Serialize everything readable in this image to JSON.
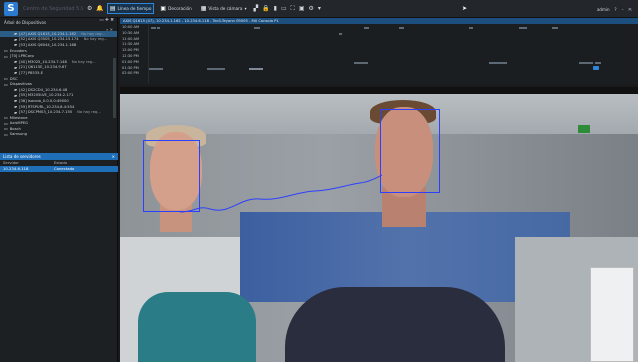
{
  "app": {
    "title": "Centro de Seguridad 5.9",
    "logo_letter": "S"
  },
  "toolbar": {
    "tabs": [
      {
        "label": "Línea de tiempo",
        "icon": "timeline-icon",
        "active": true
      },
      {
        "label": "Decoración",
        "icon": "decoration-icon",
        "active": false
      },
      {
        "label": "Vista de cámara",
        "icon": "grid-icon",
        "active": false
      }
    ],
    "user": "admin",
    "accent_color": "#2f86d8"
  },
  "left_panel": {
    "header": "Árbol de Dispositivos",
    "tree": [
      {
        "label": "[47] AXIS Q1615_10.234.1.162",
        "extra": "No hay reg...",
        "icon": "camera-icon",
        "selected": true
      },
      {
        "label": "[52] AXIS Q3505_10.234.15.174",
        "extra": "No hay reg...",
        "icon": "camera-icon",
        "selected": false
      },
      {
        "label": "[53] AXIS Q6044_10.234.1.168",
        "extra": "",
        "icon": "camera-icon",
        "selected": false
      },
      {
        "label": "Encoders",
        "extra": "",
        "icon": "folder-icon",
        "selected": false
      },
      {
        "label": "[70] LPRCorp",
        "extra": "",
        "icon": "folder-icon",
        "selected": false
      },
      {
        "label": "[40] M3025_10.234.7.148",
        "extra": "No hay reg...",
        "icon": "camera-icon",
        "selected": false
      },
      {
        "label": "[21] Q6115E_10.234.9.67",
        "extra": "",
        "icon": "camera-icon",
        "selected": false
      },
      {
        "label": "[77] P8535-E",
        "extra": "",
        "icon": "camera-icon",
        "selected": false
      },
      {
        "label": "DSC",
        "extra": "",
        "icon": "folder-icon",
        "selected": false
      },
      {
        "label": "Dispositivos",
        "extra": "",
        "icon": "folder-icon",
        "selected": false
      },
      {
        "label": "[42] DS2CD4_10.234.6.48",
        "extra": "",
        "icon": "camera-icon",
        "selected": false
      },
      {
        "label": "[55] M3205LVE_10.234.2.171",
        "extra": "",
        "icon": "camera-icon",
        "selected": false
      },
      {
        "label": "[38] Isonoia_0.0.0.0:49000",
        "extra": "",
        "icon": "camera-icon",
        "selected": false
      },
      {
        "label": "[59] RTSPURL_10.234.8.4:554",
        "extra": "",
        "icon": "camera-icon",
        "selected": false
      },
      {
        "label": "[57] DSCPM03_10.234.7.155",
        "extra": "No hay reg...",
        "icon": "camera-icon",
        "selected": false
      },
      {
        "label": "Milestone",
        "extra": "",
        "icon": "folder-icon",
        "selected": false
      },
      {
        "label": "AxisMPEG",
        "extra": "",
        "icon": "folder-icon",
        "selected": false
      },
      {
        "label": "Bosch",
        "extra": "",
        "icon": "folder-icon",
        "selected": false
      },
      {
        "label": "Samsung",
        "extra": "",
        "icon": "folder-icon",
        "selected": false
      }
    ],
    "services": {
      "header": "Lista de servidores",
      "col_server": "Servidor",
      "col_state": "Estado",
      "rows": [
        {
          "server": "10.234.6.118",
          "state": "Conectado"
        }
      ]
    }
  },
  "timeline": {
    "camera_tab": "AXIS Q1615 (47), 10.234.1.162 - 10.234.6.118 - TecS-Teyonn 09005 - MX Consola P1",
    "times": [
      "10:00 AM",
      "10:30 AM",
      "11:00 AM",
      "11:30 AM",
      "12:00 PM",
      "12:30 PM",
      "01:00 PM",
      "01:30 PM",
      "02:00 PM"
    ]
  }
}
